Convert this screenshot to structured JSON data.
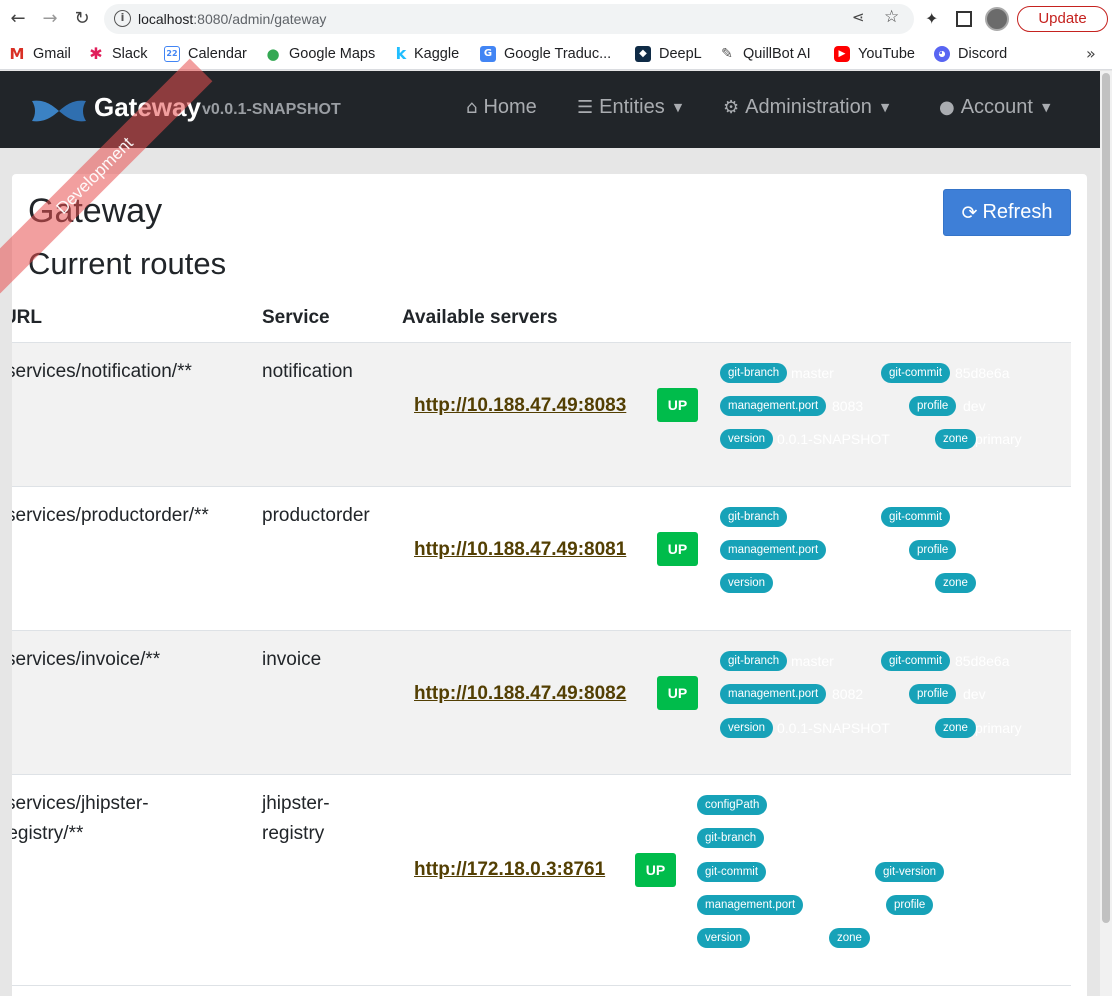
{
  "browser": {
    "url_host": "localhost",
    "url_rest": ":8080/admin/gateway",
    "update_label": "Update",
    "bookmarks": [
      "Gmail",
      "Slack",
      "Calendar",
      "Google Maps",
      "Kaggle",
      "Google Traduc...",
      "DeepL",
      "QuillBot AI",
      "YouTube",
      "Discord"
    ],
    "bookmark_calendar_day": "22",
    "more_label": "»"
  },
  "app": {
    "brand": "Gateway",
    "version": "v0.0.1-SNAPSHOT",
    "ribbon": "Development",
    "nav": {
      "home": "Home",
      "entities": "Entities",
      "administration": "Administration",
      "account": "Account"
    }
  },
  "page": {
    "title": "Gateway",
    "refresh_label": "Refresh",
    "section_title": "Current routes",
    "columns": {
      "url": "URL",
      "service": "Service",
      "servers": "Available servers"
    }
  },
  "routes": [
    {
      "url": "services/notification/**",
      "service": "notification",
      "server": "http://10.188.47.49:8083",
      "status": "UP",
      "metadata": [
        {
          "key": "git-branch",
          "value": "master"
        },
        {
          "key": "git-commit",
          "value": "85d8e6a"
        },
        {
          "key": "management.port",
          "value": "8083"
        },
        {
          "key": "profile",
          "value": "dev"
        },
        {
          "key": "version",
          "value": "0.0.1-SNAPSHOT"
        },
        {
          "key": "zone",
          "value": "primary"
        }
      ]
    },
    {
      "url": "services/productorder/**",
      "service": "productorder",
      "server": "http://10.188.47.49:8081",
      "status": "UP",
      "metadata": [
        {
          "key": "git-branch",
          "value": ""
        },
        {
          "key": "git-commit",
          "value": ""
        },
        {
          "key": "management.port",
          "value": ""
        },
        {
          "key": "profile",
          "value": ""
        },
        {
          "key": "version",
          "value": ""
        },
        {
          "key": "zone",
          "value": ""
        }
      ]
    },
    {
      "url": "services/invoice/**",
      "service": "invoice",
      "server": "http://10.188.47.49:8082",
      "status": "UP",
      "metadata": [
        {
          "key": "git-branch",
          "value": "master"
        },
        {
          "key": "git-commit",
          "value": "85d8e6a"
        },
        {
          "key": "management.port",
          "value": "8082"
        },
        {
          "key": "profile",
          "value": "dev"
        },
        {
          "key": "version",
          "value": "0.0.1-SNAPSHOT"
        },
        {
          "key": "zone",
          "value": "primary"
        }
      ]
    },
    {
      "url_line1": "services/jhipster-",
      "url_line2": "registry/**",
      "service_line1": "jhipster-",
      "service_line2": "registry",
      "server": "http://172.18.0.3:8761",
      "status": "UP",
      "metadata": [
        {
          "key": "configPath",
          "value": ""
        },
        {
          "key": "git-branch",
          "value": ""
        },
        {
          "key": "git-commit",
          "value": ""
        },
        {
          "key": "git-version",
          "value": ""
        },
        {
          "key": "management.port",
          "value": ""
        },
        {
          "key": "profile",
          "value": ""
        },
        {
          "key": "version",
          "value": ""
        },
        {
          "key": "zone",
          "value": ""
        }
      ]
    }
  ]
}
